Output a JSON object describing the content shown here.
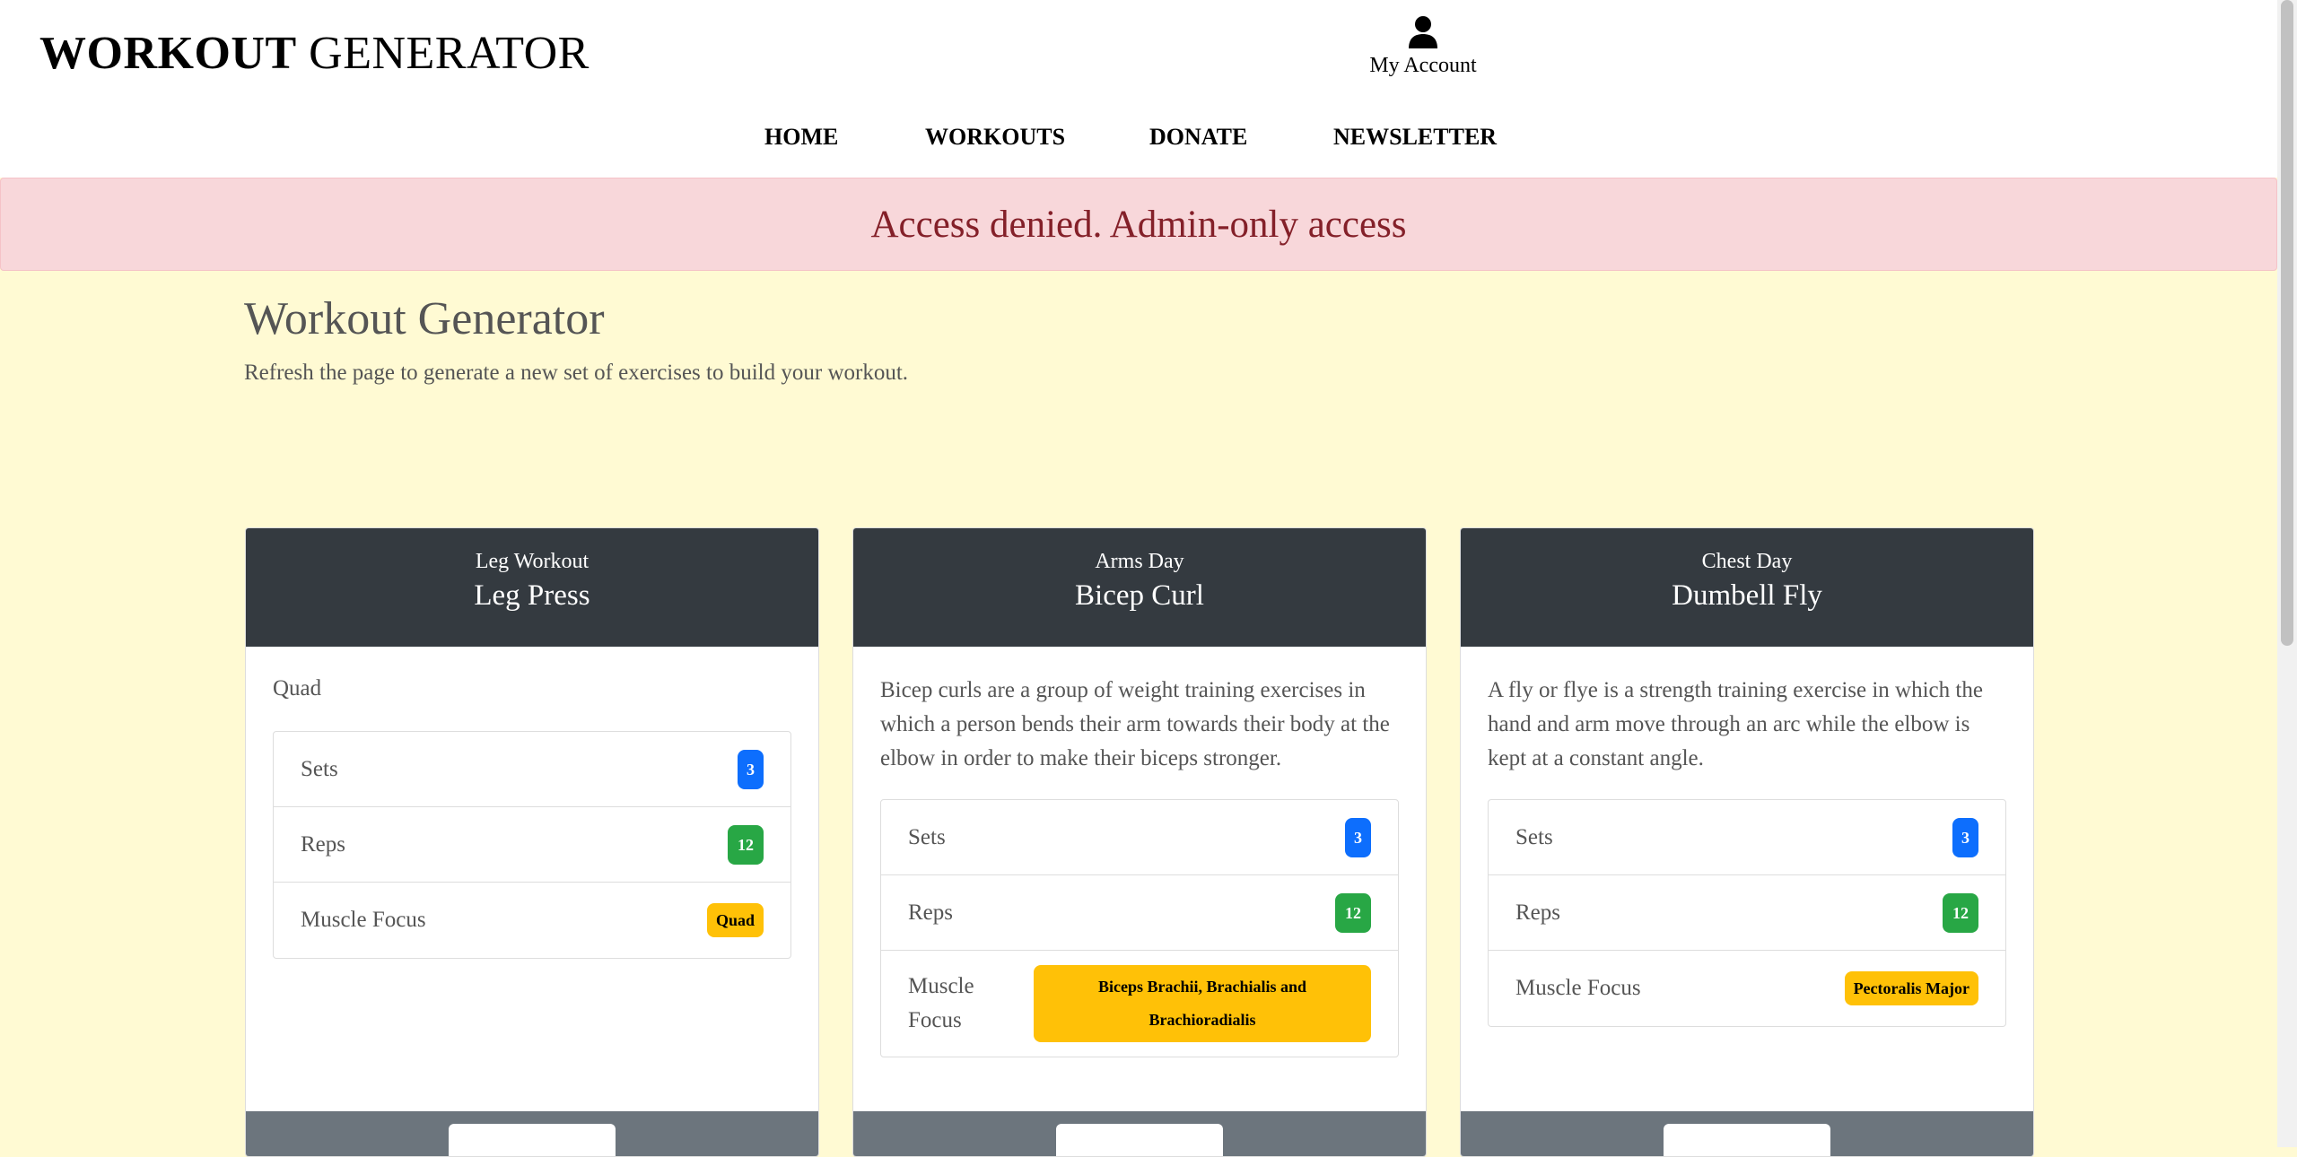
{
  "header": {
    "brand_bold": "WORKOUT",
    "brand_rest": " GENERATOR",
    "account_label": "My Account",
    "nav": [
      {
        "label": "HOME"
      },
      {
        "label": "WORKOUTS"
      },
      {
        "label": "DONATE"
      },
      {
        "label": "NEWSLETTER"
      }
    ]
  },
  "alert": {
    "text": "Access denied. Admin-only access"
  },
  "main": {
    "title": "Workout Generator",
    "lead": "Refresh the page to generate a new set of exercises to build your workout."
  },
  "cards": [
    {
      "category": "Leg Workout",
      "name": "Leg Press",
      "description": "Quad",
      "sets_label": "Sets",
      "sets": "3",
      "reps_label": "Reps",
      "reps": "12",
      "focus_label": "Muscle Focus",
      "focus": "Quad"
    },
    {
      "category": "Arms Day",
      "name": "Bicep Curl",
      "description": "Bicep curls are a group of weight training exercises in which a person bends their arm towards their body at the elbow in order to make their biceps stronger.",
      "sets_label": "Sets",
      "sets": "3",
      "reps_label": "Reps",
      "reps": "12",
      "focus_label": "Muscle Focus",
      "focus": "Biceps Brachii, Brachialis and Brachioradialis"
    },
    {
      "category": "Chest Day",
      "name": "Dumbell Fly",
      "description": "A fly or flye is a strength training exercise in which the hand and arm move through an arc while the elbow is kept at a constant angle.",
      "sets_label": "Sets",
      "sets": "3",
      "reps_label": "Reps",
      "reps": "12",
      "focus_label": "Muscle Focus",
      "focus": "Pectoralis Major"
    }
  ],
  "colors": {
    "page_bg": "#fffad3",
    "alert_bg": "#f8d7da",
    "alert_text": "#842029",
    "card_head": "#343a40",
    "card_foot": "#6c757d",
    "badge_sets": "#0d6efd",
    "badge_reps": "#28a745",
    "badge_focus": "#ffc107"
  },
  "icons": {
    "account": "user-icon"
  }
}
